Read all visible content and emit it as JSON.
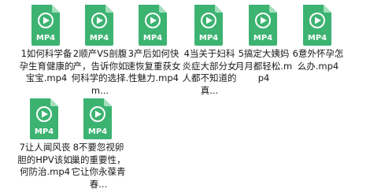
{
  "icon": {
    "name": "mp4-file-icon",
    "badge_text": "MP4",
    "color": "#3cb371",
    "fold_color": "#a5dfbd"
  },
  "files": [
    {
      "name": "1如何科学备孕生育健康的宝宝.mp4",
      "display": "1如何科学备孕生育健康的宝宝.mp4"
    },
    {
      "name": "2顺产VS剖腹产，告诉你如何科学的选择.mp4",
      "display": "2顺产VS剖腹产，告诉你如何科学的选择.m..."
    },
    {
      "name": "3产后如何快速恢复重获女性魅力.mp4",
      "display": "3产后如何快速恢复重获女性魅力.mp4"
    },
    {
      "name": "4当关于妇科炎症大部分女人都不知道的真相.mp4",
      "display": "4当关于妇科炎症大部分女人都不知道的真..."
    },
    {
      "name": "5搞定大姨妈月月都轻松.mp4",
      "display": "5搞定大姨妈月月都轻松.mp4"
    },
    {
      "name": "6意外怀孕怎么办.mp4",
      "display": "6意外怀孕怎么办.mp4"
    },
    {
      "name": "7让人闻风丧胆的HPV该如何防治.mp4",
      "display": "7让人闻风丧胆的HPV该如何防治.mp4"
    },
    {
      "name": "8不要忽视卵巢的重要性，它让你永葆青春.mp4",
      "display": "8不要忽视卵巢的重要性，它让你永葆青春..."
    }
  ]
}
